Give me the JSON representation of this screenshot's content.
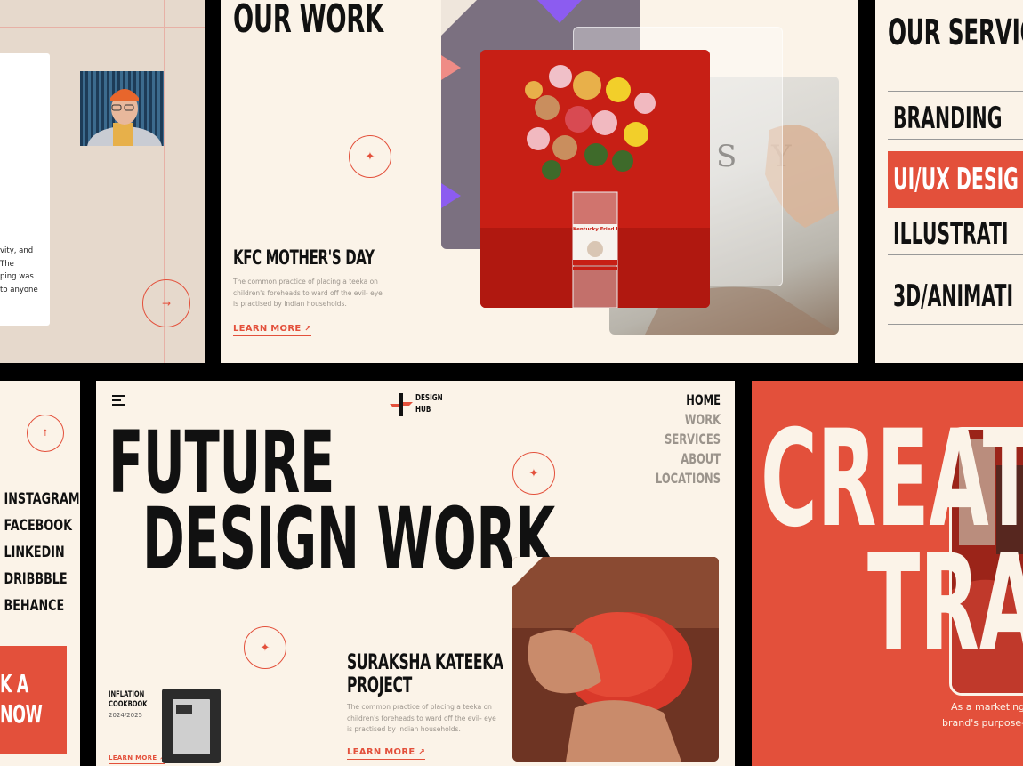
{
  "panel_profile": {
    "body_lines": [
      "vity, and",
      "The",
      "ping was",
      "to anyone"
    ]
  },
  "our_work": {
    "title": "OUR WORK",
    "project_title": "KFC MOTHER'S DAY",
    "body": "The common practice of placing a teeka on children's foreheads to ward off the evil- eye is practised by Indian households.",
    "learn_more": "LEARN MORE",
    "jar_label": "Kentucky Fried Bouq",
    "photo_letters": "S Y"
  },
  "services": {
    "title": "OUR SERVIC",
    "items": [
      {
        "label": "BRANDING",
        "active": false
      },
      {
        "label": "UI/UX DESIG",
        "active": true
      },
      {
        "label": "ILLUSTRATI",
        "active": false
      },
      {
        "label": "3D/ANIMATI",
        "active": false
      }
    ]
  },
  "social": {
    "items": [
      "INSTAGRAM",
      "FACEBOOK",
      "LINKEDIN",
      "DRIBBBLE",
      "BEHANCE"
    ],
    "cta_line1": "K A",
    "cta_line2": "NOW"
  },
  "hero": {
    "logo_line1": "DESIGN",
    "logo_line2": "HUB",
    "nav": [
      "HOME",
      "WORK",
      "SERVICES",
      "ABOUT",
      "LOCATIONS"
    ],
    "active_nav": "HOME",
    "headline_line1": "FUTURE",
    "headline_line2": "DESIGN WORK",
    "project_title_line1": "SURAKSHA KATEEKA",
    "project_title_line2": "PROJECT",
    "body": "The common practice of placing a teeka on children's foreheads to ward off the evil- eye is practised by Indian households.",
    "learn_more": "LEARN MORE",
    "book_title_line1": "INFLATION",
    "book_title_line2": "COOKBOOK",
    "book_years": "2024/2025",
    "book_learn_more": "LEARN MORE"
  },
  "create_panel": {
    "line1": "CREAT",
    "line2": "TRA",
    "tagline_line1": "As a marketing",
    "tagline_line2": "brand's purpose—"
  },
  "colors": {
    "accent": "#e3503b",
    "cream": "#fbf3e8",
    "ink": "#111111"
  }
}
